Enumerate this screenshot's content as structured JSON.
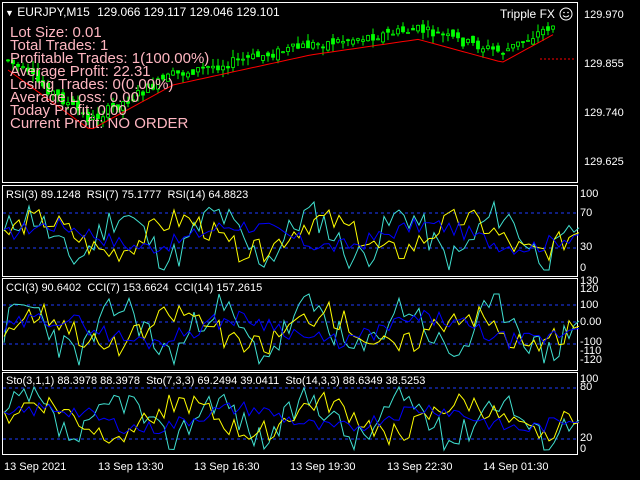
{
  "header": {
    "symbol_info": "EURJPY,M15",
    "ohlc": "129.066 129.117 129.046 129.101",
    "brand": "Tripple FX"
  },
  "stats": [
    "Lot Size: 0.01",
    "Total Trades: 1",
    "Profitable Trades: 1(100.00%)",
    "Average Profit: 22.31",
    "Losing Trades: 0(0.00%)",
    "Average Loss: 0.00",
    "Today Profit: 0.00",
    "Current Profit: NO ORDER"
  ],
  "price_axis": [
    "129.970",
    "129.855",
    "129.740",
    "129.625"
  ],
  "rsi": {
    "labels": [
      "RSI(3) 89.1248",
      "RSI(7) 75.1777",
      "RSI(14) 64.8823"
    ],
    "axis": [
      "100",
      "70",
      "30",
      "0"
    ]
  },
  "cci": {
    "labels": [
      "CCI(3) 90.6402",
      "CCI(7) 153.6624",
      "CCI(14) 157.2615"
    ],
    "axis": [
      "130",
      "120",
      "100",
      "0.00",
      "-100",
      "-110",
      "-120"
    ]
  },
  "sto": {
    "labels": [
      "Sto(3,1,1) 88.3978 88.3978",
      "Sto(7,3,3) 69.2494 39.0411",
      "Sto(14,3,3) 88.6349 38.5253"
    ],
    "axis": [
      "100",
      "80",
      "20",
      "0"
    ]
  },
  "time_axis": [
    "13 Sep 2021",
    "13 Sep 13:30",
    "13 Sep 16:30",
    "13 Sep 19:30",
    "13 Sep 22:30",
    "14 Sep 01:30"
  ],
  "colors": {
    "bull": "#00ff00",
    "bear": "#00ff00",
    "ma": "#ff0000",
    "fast": "#40e0d0",
    "mid": "#ffff00",
    "slow": "#0000ff",
    "level": "#1e3cff"
  },
  "icon": "smiley-icon"
}
